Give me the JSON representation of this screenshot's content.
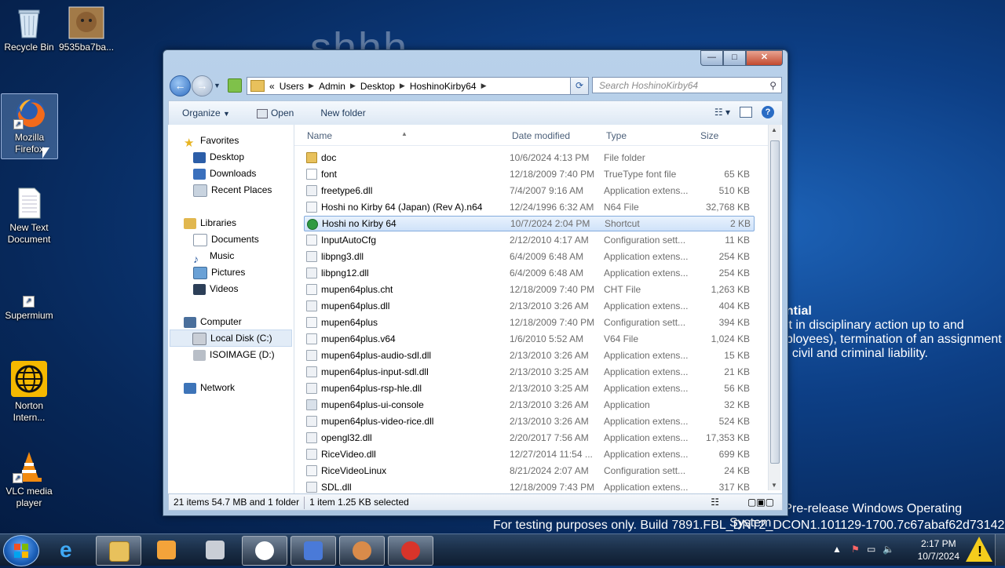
{
  "desktop": {
    "watermark_bg": "shhh...",
    "notice_title": "ential",
    "notice_line1": "ult in disciplinary action up to and",
    "notice_line2": "nployees), termination of an assignment",
    "notice_line3": "al civil and criminal liability.",
    "build_line1": "Microsoft Pre-release Windows Operating System",
    "build_line2": "For testing purposes only. Build 7891.FBL_DNT2_DCON1.101129-1700.7c67abaf62d73142",
    "icons": [
      {
        "label": "Recycle Bin"
      },
      {
        "label": "9535ba7ba..."
      },
      {
        "label": "Mozilla Firefox"
      },
      {
        "label": "New Text Document"
      },
      {
        "label": "Supermium"
      },
      {
        "label": "Norton Intern..."
      },
      {
        "label": "VLC media player"
      }
    ]
  },
  "explorer": {
    "breadcrumb": [
      "«",
      "Users",
      "Admin",
      "Desktop",
      "HoshinoKirby64"
    ],
    "search_placeholder": "Search HoshinoKirby64",
    "toolbar": {
      "organize": "Organize",
      "open": "Open",
      "new_folder": "New folder"
    },
    "nav": {
      "favorites": "Favorites",
      "desktop": "Desktop",
      "downloads": "Downloads",
      "recent": "Recent Places",
      "libraries": "Libraries",
      "documents": "Documents",
      "music": "Music",
      "pictures": "Pictures",
      "videos": "Videos",
      "computer": "Computer",
      "local_disk": "Local Disk (C:)",
      "isoimage": "ISOIMAGE (D:)",
      "network": "Network"
    },
    "columns": {
      "name": "Name",
      "date": "Date modified",
      "type": "Type",
      "size": "Size"
    },
    "files": [
      {
        "name": "doc",
        "date": "10/6/2024 4:13 PM",
        "type": "File folder",
        "size": ""
      },
      {
        "name": "font",
        "date": "12/18/2009 7:40 PM",
        "type": "TrueType font file",
        "size": "65 KB"
      },
      {
        "name": "freetype6.dll",
        "date": "7/4/2007 9:16 AM",
        "type": "Application extens...",
        "size": "510 KB"
      },
      {
        "name": "Hoshi no Kirby 64 (Japan) (Rev A).n64",
        "date": "12/24/1996 6:32 AM",
        "type": "N64 File",
        "size": "32,768 KB"
      },
      {
        "name": "Hoshi no Kirby 64",
        "date": "10/7/2024 2:04 PM",
        "type": "Shortcut",
        "size": "2 KB"
      },
      {
        "name": "InputAutoCfg",
        "date": "2/12/2010 4:17 AM",
        "type": "Configuration sett...",
        "size": "11 KB"
      },
      {
        "name": "libpng3.dll",
        "date": "6/4/2009 6:48 AM",
        "type": "Application extens...",
        "size": "254 KB"
      },
      {
        "name": "libpng12.dll",
        "date": "6/4/2009 6:48 AM",
        "type": "Application extens...",
        "size": "254 KB"
      },
      {
        "name": "mupen64plus.cht",
        "date": "12/18/2009 7:40 PM",
        "type": "CHT File",
        "size": "1,263 KB"
      },
      {
        "name": "mupen64plus.dll",
        "date": "2/13/2010 3:26 AM",
        "type": "Application extens...",
        "size": "404 KB"
      },
      {
        "name": "mupen64plus",
        "date": "12/18/2009 7:40 PM",
        "type": "Configuration sett...",
        "size": "394 KB"
      },
      {
        "name": "mupen64plus.v64",
        "date": "1/6/2010 5:52 AM",
        "type": "V64 File",
        "size": "1,024 KB"
      },
      {
        "name": "mupen64plus-audio-sdl.dll",
        "date": "2/13/2010 3:26 AM",
        "type": "Application extens...",
        "size": "15 KB"
      },
      {
        "name": "mupen64plus-input-sdl.dll",
        "date": "2/13/2010 3:25 AM",
        "type": "Application extens...",
        "size": "21 KB"
      },
      {
        "name": "mupen64plus-rsp-hle.dll",
        "date": "2/13/2010 3:25 AM",
        "type": "Application extens...",
        "size": "56 KB"
      },
      {
        "name": "mupen64plus-ui-console",
        "date": "2/13/2010 3:26 AM",
        "type": "Application",
        "size": "32 KB"
      },
      {
        "name": "mupen64plus-video-rice.dll",
        "date": "2/13/2010 3:26 AM",
        "type": "Application extens...",
        "size": "524 KB"
      },
      {
        "name": "opengl32.dll",
        "date": "2/20/2017 7:56 AM",
        "type": "Application extens...",
        "size": "17,353 KB"
      },
      {
        "name": "RiceVideo.dll",
        "date": "12/27/2014 11:54 ...",
        "type": "Application extens...",
        "size": "699 KB"
      },
      {
        "name": "RiceVideoLinux",
        "date": "8/21/2024 2:07 AM",
        "type": "Configuration sett...",
        "size": "24 KB"
      },
      {
        "name": "SDL.dll",
        "date": "12/18/2009 7:43 PM",
        "type": "Application extens...",
        "size": "317 KB"
      }
    ],
    "status_left": "21 items 54.7 MB and 1 folder",
    "status_right": "1 item 1.25 KB selected"
  },
  "taskbar": {
    "time": "2:17 PM",
    "date": "10/7/2024"
  }
}
